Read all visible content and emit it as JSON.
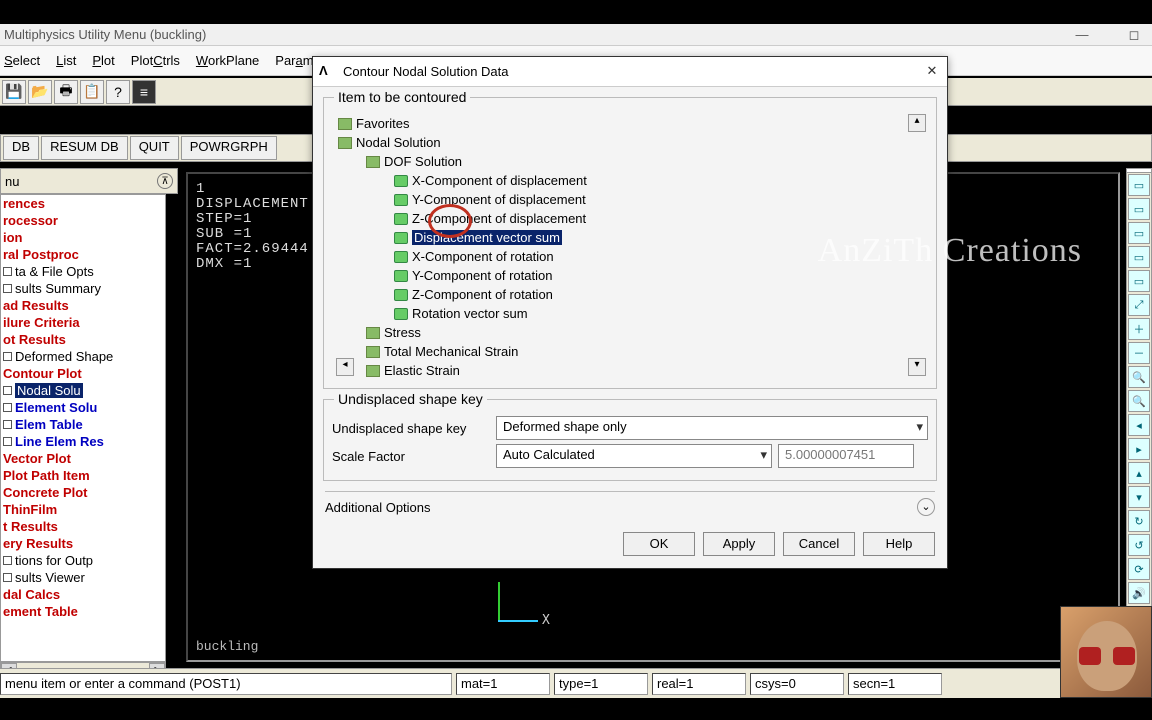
{
  "window": {
    "title": "Multiphysics Utility Menu (buckling)"
  },
  "menubar": [
    "Select",
    "List",
    "Plot",
    "PlotCtrls",
    "WorkPlane",
    "Param"
  ],
  "quickbar": [
    "DB",
    "RESUM DB",
    "QUIT",
    "POWRGRPH"
  ],
  "sidebar_header": "nu",
  "sidebar": [
    {
      "t": "rences",
      "c": "red",
      "sq": false
    },
    {
      "t": "rocessor",
      "c": "red",
      "sq": false
    },
    {
      "t": "ion",
      "c": "red",
      "sq": false
    },
    {
      "t": "ral Postproc",
      "c": "red",
      "sq": false
    },
    {
      "t": "ta & File Opts",
      "c": "",
      "sq": true
    },
    {
      "t": "sults Summary",
      "c": "",
      "sq": true
    },
    {
      "t": "ad Results",
      "c": "red",
      "sq": false
    },
    {
      "t": "ilure Criteria",
      "c": "red",
      "sq": false
    },
    {
      "t": "ot Results",
      "c": "red",
      "sq": false
    },
    {
      "t": "Deformed Shape",
      "c": "",
      "sq": true
    },
    {
      "t": "Contour Plot",
      "c": "red",
      "sq": false
    },
    {
      "t": "Nodal Solu",
      "c": "sel",
      "sq": true
    },
    {
      "t": "Element Solu",
      "c": "blue",
      "sq": true
    },
    {
      "t": "Elem Table",
      "c": "blue",
      "sq": true
    },
    {
      "t": "Line Elem Res",
      "c": "blue",
      "sq": true
    },
    {
      "t": "Vector Plot",
      "c": "red",
      "sq": false
    },
    {
      "t": "Plot Path Item",
      "c": "red",
      "sq": false
    },
    {
      "t": "Concrete Plot",
      "c": "red",
      "sq": false
    },
    {
      "t": "ThinFilm",
      "c": "red",
      "sq": false
    },
    {
      "t": "t Results",
      "c": "red",
      "sq": false
    },
    {
      "t": "ery Results",
      "c": "red",
      "sq": false
    },
    {
      "t": "tions for Outp",
      "c": "",
      "sq": true
    },
    {
      "t": "sults Viewer",
      "c": "",
      "sq": true
    },
    {
      "t": "dal Calcs",
      "c": "red",
      "sq": false
    },
    {
      "t": "ement Table",
      "c": "red",
      "sq": false
    }
  ],
  "gfx": {
    "lines": [
      "1",
      "DISPLACEMENT",
      "STEP=1",
      "SUB =1",
      "FACT=2.69444",
      "DMX =1"
    ],
    "footer": "buckling",
    "axis_x": "X"
  },
  "numbox": "1",
  "dialog": {
    "title": "Contour Nodal Solution Data",
    "group1": "Item to be contoured",
    "tree": {
      "favorites": "Favorites",
      "nodal": "Nodal Solution",
      "dof": "DOF Solution",
      "items": [
        "X-Component of displacement",
        "Y-Component of displacement",
        "Z-Component of displacement",
        "Displacement vector sum",
        "X-Component of rotation",
        "Y-Component of rotation",
        "Z-Component of rotation",
        "Rotation vector sum"
      ],
      "stress": "Stress",
      "tms": "Total Mechanical Strain",
      "es": "Elastic Strain"
    },
    "group2": "Undisplaced shape key",
    "shape_key_lbl": "Undisplaced shape key",
    "shape_key_val": "Deformed shape only",
    "scale_lbl": "Scale Factor",
    "scale_val": "Auto Calculated",
    "scale_num": "5.00000007451",
    "addl": "Additional Options",
    "buttons": {
      "ok": "OK",
      "apply": "Apply",
      "cancel": "Cancel",
      "help": "Help"
    }
  },
  "status": {
    "cmd": "menu item or enter a command (POST1)",
    "mat": "mat=1",
    "type": "type=1",
    "real": "real=1",
    "csys": "csys=0",
    "secn": "secn=1"
  },
  "watermark": "AnZiTh Creations"
}
